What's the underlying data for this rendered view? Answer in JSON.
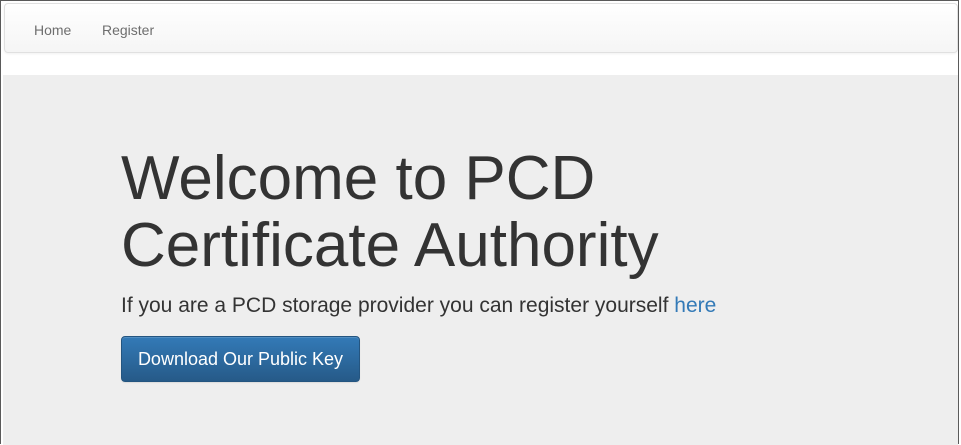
{
  "navbar": {
    "items": [
      {
        "label": "Home"
      },
      {
        "label": "Register"
      }
    ]
  },
  "hero": {
    "title": "Welcome to PCD Certificate Authority",
    "text": "If you are a PCD storage provider you can register yourself",
    "link_label": "here",
    "button_label": "Download Our Public Key"
  },
  "colors": {
    "link": "#337ab7",
    "button": "#265a88",
    "jumbotron_bg": "#eeeeee",
    "text": "#333333"
  }
}
